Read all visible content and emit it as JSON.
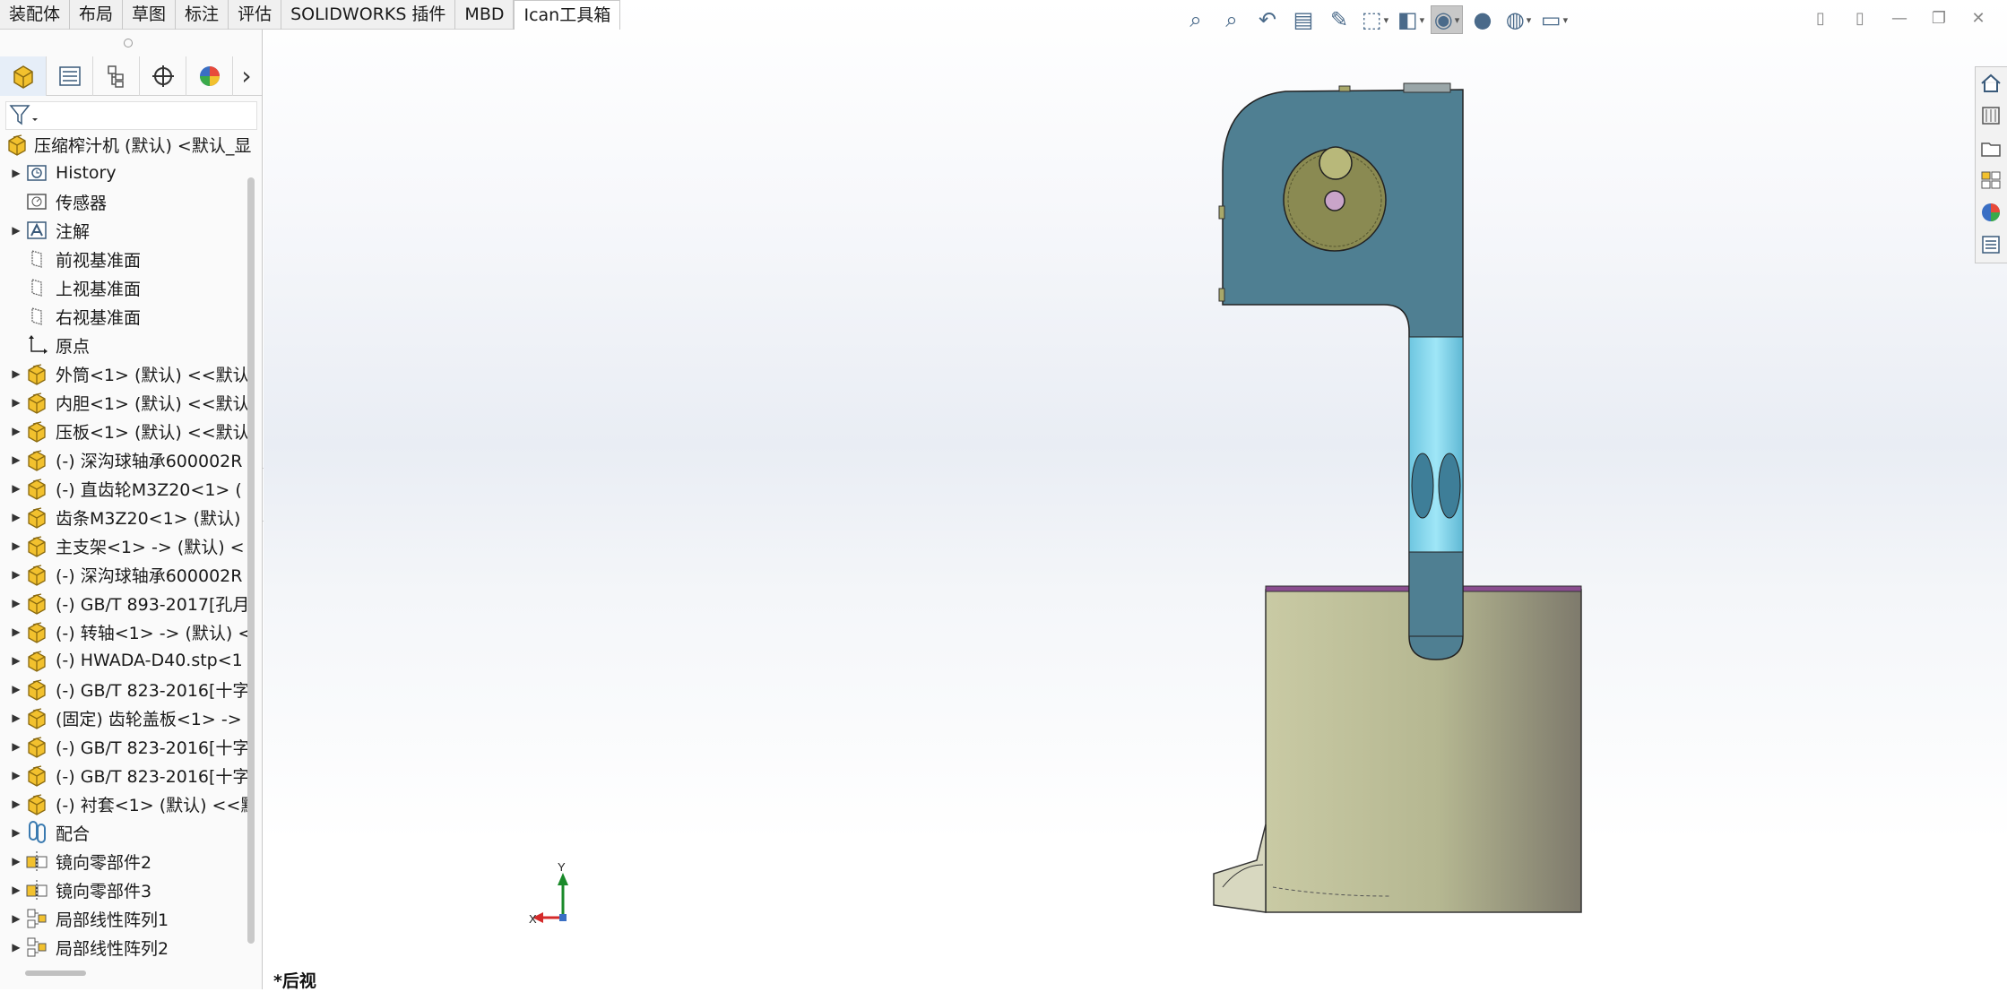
{
  "command_tabs": [
    {
      "label": "装配体",
      "active": false
    },
    {
      "label": "布局",
      "active": false
    },
    {
      "label": "草图",
      "active": false
    },
    {
      "label": "标注",
      "active": false
    },
    {
      "label": "评估",
      "active": false
    },
    {
      "label": "SOLIDWORKS 插件",
      "active": false
    },
    {
      "label": "MBD",
      "active": false
    },
    {
      "label": "Ican工具箱",
      "active": true
    }
  ],
  "tree": {
    "root": "压缩榨汁机 (默认) <默认_显示",
    "items": [
      {
        "label": "History",
        "expandable": true,
        "icon": "history-icon"
      },
      {
        "label": "传感器",
        "expandable": false,
        "icon": "sensor-icon"
      },
      {
        "label": "注解",
        "expandable": true,
        "icon": "annotation-icon"
      },
      {
        "label": "前视基准面",
        "expandable": false,
        "icon": "plane-icon"
      },
      {
        "label": "上视基准面",
        "expandable": false,
        "icon": "plane-icon"
      },
      {
        "label": "右视基准面",
        "expandable": false,
        "icon": "plane-icon"
      },
      {
        "label": "原点",
        "expandable": false,
        "icon": "origin-icon"
      },
      {
        "label": "外筒<1> (默认) <<默认",
        "expandable": true,
        "icon": "part-icon"
      },
      {
        "label": "内胆<1> (默认) <<默认",
        "expandable": true,
        "icon": "part-icon"
      },
      {
        "label": "压板<1> (默认) <<默认",
        "expandable": true,
        "icon": "part-icon"
      },
      {
        "label": "(-) 深沟球轴承600002R",
        "expandable": true,
        "icon": "part-icon"
      },
      {
        "label": "(-) 直齿轮M3Z20<1> (",
        "expandable": true,
        "icon": "part-icon"
      },
      {
        "label": "齿条M3Z20<1> (默认)",
        "expandable": true,
        "icon": "part-icon"
      },
      {
        "label": "主支架<1> -> (默认) <",
        "expandable": true,
        "icon": "part-icon"
      },
      {
        "label": "(-) 深沟球轴承600002R",
        "expandable": true,
        "icon": "part-icon"
      },
      {
        "label": "(-) GB/T 893-2017[孔月",
        "expandable": true,
        "icon": "part-icon"
      },
      {
        "label": "(-) 转轴<1> -> (默认) <",
        "expandable": true,
        "icon": "part-icon"
      },
      {
        "label": "(-) HWADA-D40.stp<1",
        "expandable": true,
        "icon": "part-icon"
      },
      {
        "label": "(-) GB/T 823-2016[十字",
        "expandable": true,
        "icon": "part-icon"
      },
      {
        "label": "(固定) 齿轮盖板<1> ->",
        "expandable": true,
        "icon": "part-icon"
      },
      {
        "label": "(-) GB/T 823-2016[十字",
        "expandable": true,
        "icon": "part-icon"
      },
      {
        "label": "(-) GB/T 823-2016[十字",
        "expandable": true,
        "icon": "part-icon"
      },
      {
        "label": "(-) 衬套<1> (默认) <<默",
        "expandable": true,
        "icon": "part-icon"
      },
      {
        "label": "配合",
        "expandable": true,
        "icon": "mate-icon"
      },
      {
        "label": "镜向零部件2",
        "expandable": true,
        "icon": "mirror-icon"
      },
      {
        "label": "镜向零部件3",
        "expandable": true,
        "icon": "mirror-icon"
      },
      {
        "label": "局部线性阵列1",
        "expandable": true,
        "icon": "pattern-icon"
      },
      {
        "label": "局部线性阵列2",
        "expandable": true,
        "icon": "pattern-icon"
      }
    ]
  },
  "viewport": {
    "view_name": "*后视",
    "triad": {
      "x_label": "X",
      "y_label": "Y"
    }
  },
  "colors": {
    "bracket": "#4f7f92",
    "bracket_highlight": "#7fd3ec",
    "cylinder": "#bcbd98",
    "gear": "#8a8a52",
    "rim": "#8a4d8f"
  }
}
